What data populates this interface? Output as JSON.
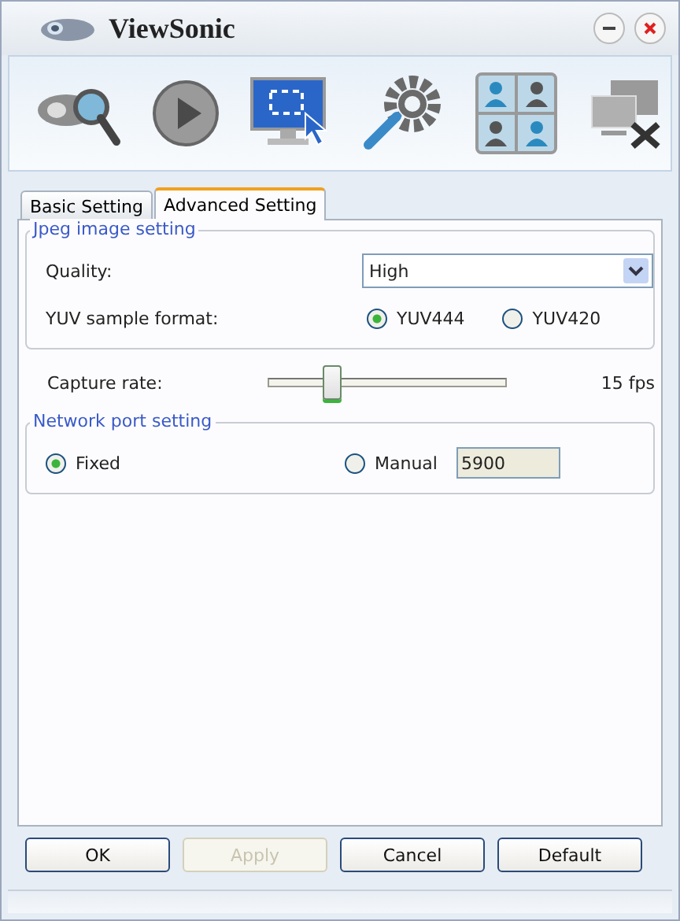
{
  "window": {
    "title": "ViewSonic"
  },
  "tabs": [
    {
      "label": "Basic Setting",
      "selected": false
    },
    {
      "label": "Advanced Setting",
      "selected": true
    }
  ],
  "jpeg": {
    "legend": "Jpeg image setting",
    "quality": {
      "label": "Quality:",
      "value": "High"
    },
    "yuv": {
      "label": "YUV sample format:",
      "options": [
        {
          "label": "YUV444",
          "selected": true
        },
        {
          "label": "YUV420",
          "selected": false
        }
      ]
    }
  },
  "capture": {
    "label": "Capture rate:",
    "level": 0.26,
    "reading": "15 fps"
  },
  "network": {
    "legend": "Network port setting",
    "options": [
      {
        "label": "Fixed",
        "selected": true
      },
      {
        "label": "Manual",
        "selected": false
      }
    ],
    "port": {
      "value": "5900",
      "disabled": true
    }
  },
  "buttons": [
    {
      "label": "OK",
      "disabled": false
    },
    {
      "label": "Apply",
      "disabled": true
    },
    {
      "label": "Cancel",
      "disabled": false
    },
    {
      "label": "Default",
      "disabled": false
    }
  ]
}
